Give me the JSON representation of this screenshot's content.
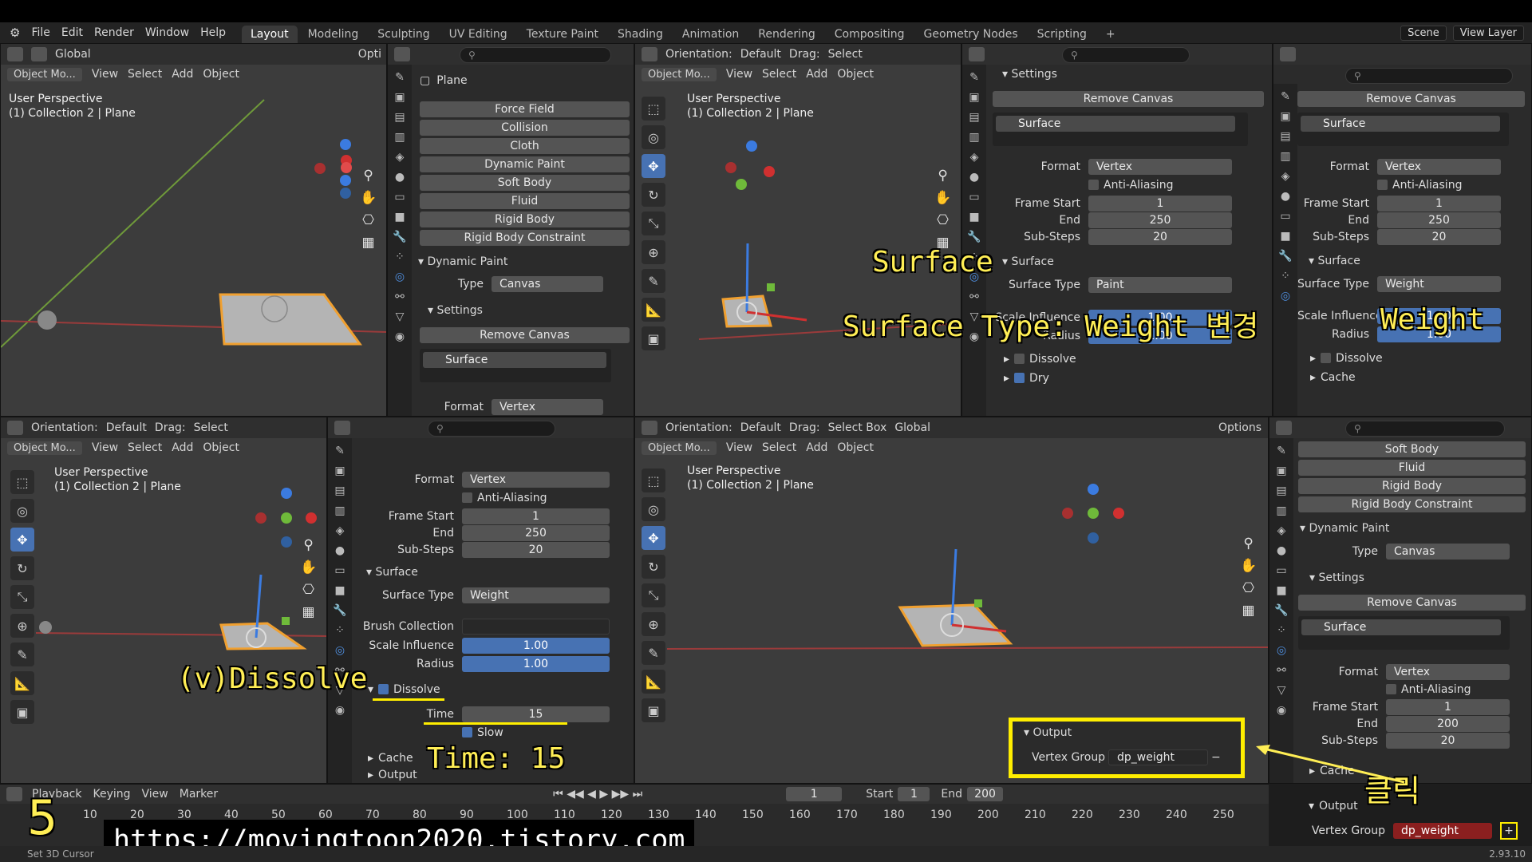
{
  "menu": {
    "file": "File",
    "edit": "Edit",
    "render": "Render",
    "window": "Window",
    "help": "Help"
  },
  "workspaces": [
    "Layout",
    "Modeling",
    "Sculpting",
    "UV Editing",
    "Texture Paint",
    "Shading",
    "Animation",
    "Rendering",
    "Compositing",
    "Geometry Nodes",
    "Scripting"
  ],
  "scene": {
    "scene_label": "Scene",
    "view_layer": "View Layer"
  },
  "viewport": {
    "mode": "Object Mo...",
    "view": "View",
    "select": "Select",
    "add": "Add",
    "object": "Object",
    "perspective": "User Perspective",
    "collection": "(1) Collection 2 | Plane",
    "global": "Global",
    "opt": "Opti",
    "orientation_label": "Orientation:",
    "orientation_value": "Default",
    "drag_label": "Drag:",
    "drag_value": "Select",
    "drag_value_box": "Select Box",
    "options": "Options"
  },
  "physics": {
    "object_name": "Plane",
    "buttons": [
      "Force Field",
      "Collision",
      "Cloth",
      "Dynamic Paint",
      "Soft Body",
      "Fluid",
      "Rigid Body",
      "Rigid Body Constraint"
    ],
    "dynamic_paint": "Dynamic Paint",
    "type_label": "Type",
    "type_value": "Canvas",
    "settings": "Settings",
    "remove_canvas": "Remove Canvas",
    "surface_item": "Surface",
    "format_label": "Format",
    "format_value": "Vertex",
    "anti_aliasing": "Anti-Aliasing",
    "frame_start_label": "Frame Start",
    "frame_start": "1",
    "end_label": "End",
    "end_250": "250",
    "end_200": "200",
    "substeps_label": "Sub-Steps",
    "substeps": "20",
    "surface_section": "Surface",
    "surface_type_label": "Surface Type",
    "surface_type_paint": "Paint",
    "surface_type_weight": "Weight",
    "brush_collection": "Brush Collection",
    "scale_influence": "Scale Influence",
    "scale_influence_value": "1.00",
    "radius": "Radius",
    "radius_value": "1.00",
    "dissolve": "Dissolve",
    "dry": "Dry",
    "time_label": "Time",
    "time_value": "15",
    "slow": "Slow",
    "cache": "Cache",
    "output": "Output",
    "vertex_group_label": "Vertex Group",
    "vertex_group_value": "dp_weight"
  },
  "timeline": {
    "playback": "Playback",
    "keying": "Keying",
    "view": "View",
    "marker": "Marker",
    "current_frame": "1",
    "start_label": "Start",
    "start": "1",
    "end_label": "End",
    "end": "200",
    "ticks": [
      "10",
      "20",
      "30",
      "40",
      "50",
      "60",
      "70",
      "80",
      "90",
      "100",
      "110",
      "120",
      "130",
      "140",
      "150",
      "160",
      "170",
      "180",
      "190",
      "200",
      "210",
      "220",
      "230",
      "240",
      "250"
    ]
  },
  "status": {
    "left": "Set 3D Cursor",
    "version": "2.93.10"
  },
  "overlays": {
    "surface": "Surface",
    "surface_type": "Surface Type: Weight 변경",
    "weight": "Weight",
    "dissolve": "(v)Dissolve",
    "time": "Time: 15",
    "click": "클릭",
    "step": "5",
    "url": "https://movingtoon2020.tistory.com"
  },
  "colors": {
    "accent": "#4772b3",
    "highlight": "#ffee00",
    "overlay_text": "#ffee55",
    "selected_object": "#f0a030"
  }
}
